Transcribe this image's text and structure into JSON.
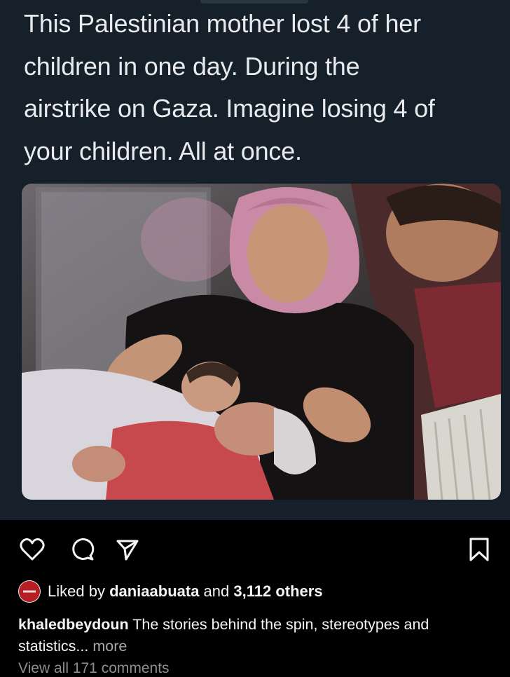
{
  "tweet": {
    "lines": [
      "This Palestinian mother lost 4 of her",
      "children in one day. During the",
      "airstrike on Gaza. Imagine losing 4 of",
      "your children. All at once."
    ]
  },
  "photo": {
    "icon": "news-photo"
  },
  "post_actions": {
    "like_icon": "heart-icon",
    "comment_icon": "comment-icon",
    "share_icon": "send-icon",
    "save_icon": "bookmark-icon"
  },
  "likes": {
    "prefix": "Liked by ",
    "user": "daniaabuata",
    "middle": " and ",
    "count": "3,112 others"
  },
  "caption": {
    "username": "khaledbeydoun",
    "text": " The stories behind the spin, stereotypes and statistics...",
    "more_label": " more"
  },
  "comments": {
    "view_all_label": "View all 171 comments"
  },
  "colors": {
    "tweet_background": "#15202b",
    "footer_background": "#000000",
    "muted_text": "#8e8e8e"
  }
}
